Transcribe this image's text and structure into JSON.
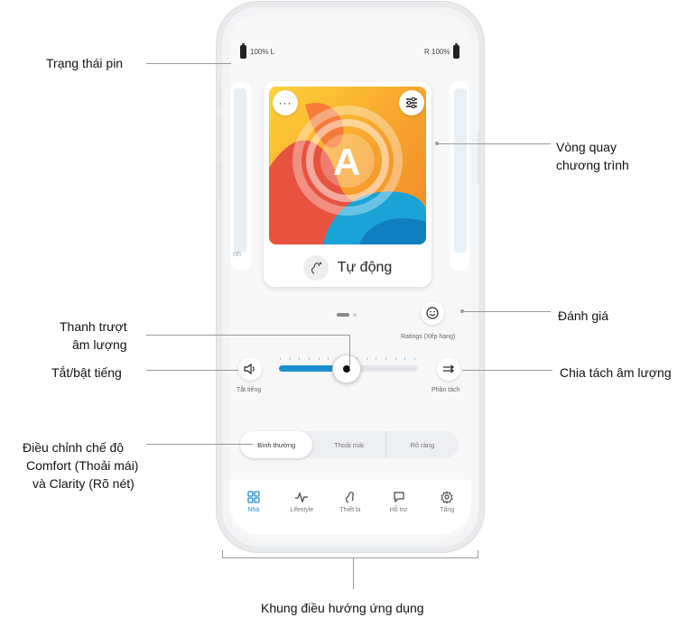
{
  "status": {
    "battery_left": "100% L",
    "battery_right": "R 100%"
  },
  "program": {
    "name": "Tự động",
    "badge_letter": "A"
  },
  "ghost_text": {
    "left": "nh"
  },
  "ratings": {
    "label": "Ratings (Xếp hạng)"
  },
  "volume": {
    "mute_label": "Tắt tiếng",
    "split_label": "Phân tách",
    "level_fraction": 0.48
  },
  "modes": {
    "items": [
      "Bình thường",
      "Thoải mái",
      "Rõ ràng"
    ],
    "selected": "Bình thường"
  },
  "nav": {
    "items": [
      {
        "label": "Nhà",
        "icon": "grid-icon",
        "active": true
      },
      {
        "label": "Lifestyle",
        "icon": "activity-icon",
        "active": false
      },
      {
        "label": "Thiết bị",
        "icon": "hearing-aid-icon",
        "active": false
      },
      {
        "label": "Hỗ trợ",
        "icon": "chat-icon",
        "active": false
      },
      {
        "label": "Tăng",
        "icon": "gear-icon",
        "active": false
      }
    ]
  },
  "callouts": {
    "battery": "Trạng thái pin",
    "program_wheel_1": "Vòng quay",
    "program_wheel_2": "chương trình",
    "rating": "Đánh giá",
    "volume_slider_1": "Thanh trượt",
    "volume_slider_2": "âm lượng",
    "mute": "Tắt/bật tiếng",
    "split": "Chia tách âm lượng",
    "mode_1": "Điều chỉnh chế độ",
    "mode_2": "Comfort (Thoải mái)",
    "mode_3": "và Clarity (Rõ nét)",
    "nav_frame": "Khung điều hướng ứng dụng"
  },
  "colors": {
    "accent": "#1c8fd1",
    "art_orange": "#f39a2e",
    "art_red": "#e8533f",
    "art_blue": "#1aa3d6"
  }
}
